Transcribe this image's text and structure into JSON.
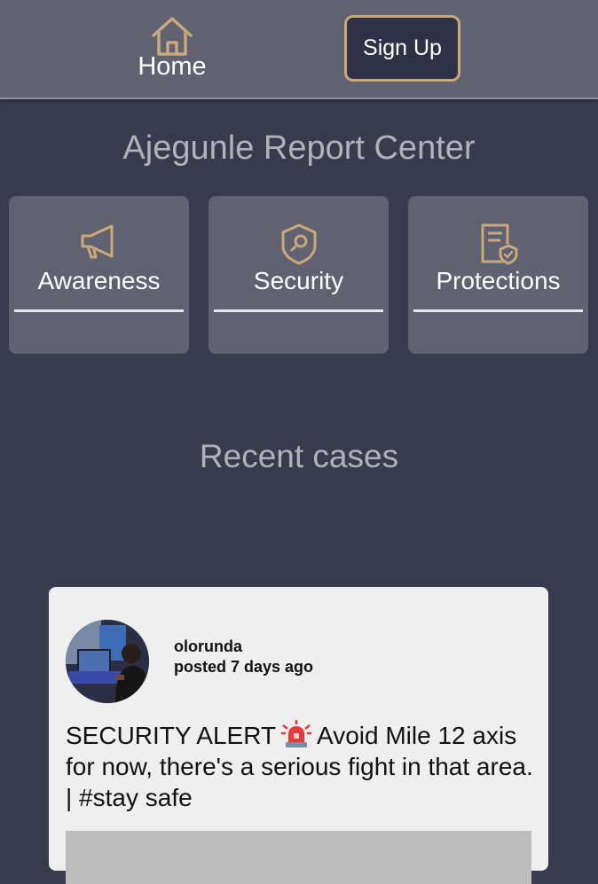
{
  "nav": {
    "home_label": "Home",
    "signup_label": "Sign Up"
  },
  "page": {
    "title": "Ajegunle Report Center",
    "recent_heading": "Recent cases"
  },
  "categories": [
    {
      "label": "Awareness",
      "icon": "megaphone-icon"
    },
    {
      "label": "Security",
      "icon": "shield-search-icon"
    },
    {
      "label": "Protections",
      "icon": "document-shield-icon"
    }
  ],
  "posts": [
    {
      "username": "olorunda",
      "posted": "posted 7 days ago",
      "text_before": "SECURITY ALERT",
      "text_after": "Avoid Mile 12 axis for now, there's a serious fight in that area. | #stay safe",
      "icon": "siren-icon"
    }
  ],
  "colors": {
    "background": "#383a4d",
    "bar": "#606272",
    "accent": "#c9a87a",
    "card": "#efefef"
  }
}
